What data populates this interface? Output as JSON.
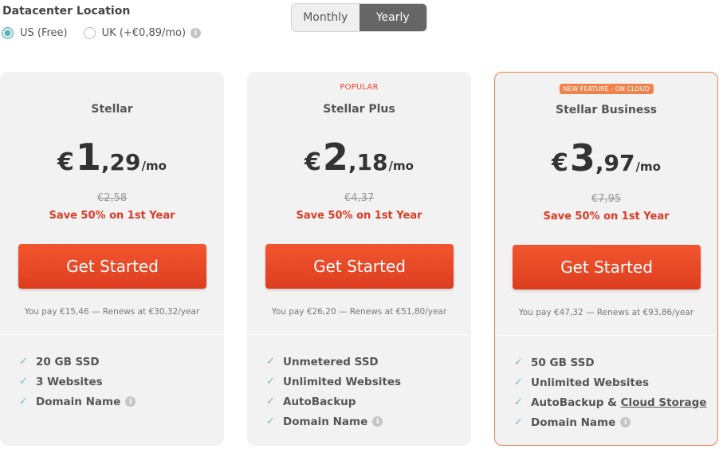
{
  "datacenter": {
    "title": "Datacenter Location",
    "options": [
      {
        "label": "US (Free)",
        "selected": true
      },
      {
        "label": "UK (+€0,89/mo)",
        "selected": false
      }
    ]
  },
  "billing_toggle": {
    "monthly_label": "Monthly",
    "yearly_label": "Yearly",
    "active": "Yearly"
  },
  "plans": [
    {
      "badge": "",
      "name": "Stellar",
      "currency": "€",
      "price_whole": "1",
      "price_cents": ",29",
      "per": "/mo",
      "old_price": "€2,58",
      "save": "Save 50% on 1st Year",
      "cta": "Get Started",
      "pay_note": "You pay €15,46 — Renews at €30,32/year",
      "features": [
        "20 GB SSD",
        "3 Websites",
        "Domain Name"
      ]
    },
    {
      "badge": "POPULAR",
      "name": "Stellar Plus",
      "currency": "€",
      "price_whole": "2",
      "price_cents": ",18",
      "per": "/mo",
      "old_price": "€4,37",
      "save": "Save 50% on 1st Year",
      "cta": "Get Started",
      "pay_note": "You pay €26,20 — Renews at €51,80/year",
      "features": [
        "Unmetered SSD",
        "Unlimited Websites",
        "AutoBackup",
        "Domain Name"
      ]
    },
    {
      "badge": "NEW FEATURE - ON CLOUD",
      "name": "Stellar Business",
      "currency": "€",
      "price_whole": "3",
      "price_cents": ",97",
      "per": "/mo",
      "old_price": "€7,95",
      "save": "Save 50% on 1st Year",
      "cta": "Get Started",
      "pay_note": "You pay €47,32 — Renews at €93,86/year",
      "features": [
        "50 GB SSD",
        "Unlimited Websites",
        "AutoBackup & ",
        "Cloud Storage",
        "Domain Name"
      ]
    }
  ],
  "icons": {
    "check": "check-icon",
    "info": "info-icon"
  },
  "colors": {
    "accent_orange": "#e8452c",
    "button_top": "#f2562f",
    "check_teal": "#7ab7bd",
    "featured_border": "#f0834c"
  }
}
